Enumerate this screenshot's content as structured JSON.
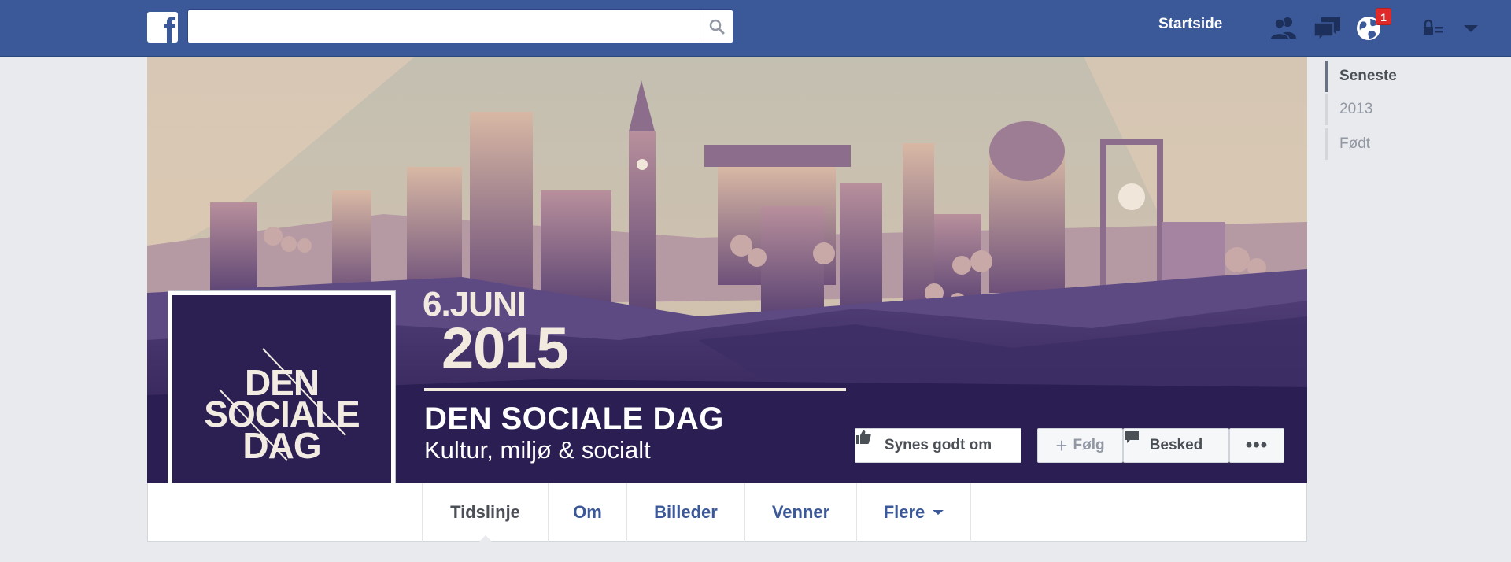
{
  "topbar": {
    "logo": "f",
    "search": {
      "value": "",
      "placeholder": ""
    },
    "home_label": "Startside",
    "notification_count": "1",
    "icons": [
      "friend-requests-icon",
      "messages-icon",
      "notifications-globe-icon",
      "privacy-lock-icon",
      "account-menu-chevron-icon"
    ]
  },
  "cover": {
    "date_day": "6.JUNI",
    "date_year": "2015",
    "page_name": "DEN SOCIALE DAG",
    "page_subtitle": "Kultur, miljø & socialt",
    "colors": {
      "sky": "#c8c2b4",
      "hills": "#3b2d63",
      "buildings": "#8c6e8c",
      "text": "#f3eadf"
    }
  },
  "profile": {
    "logo_lines": [
      "DEN",
      "SOCIALE",
      "DAG"
    ],
    "background": "#2c1f52"
  },
  "actions": {
    "like_label": "Synes godt om",
    "follow_label": "Følg",
    "message_label": "Besked",
    "more_label": "•••"
  },
  "tabs": [
    {
      "label": "Tidslinje",
      "active": true
    },
    {
      "label": "Om"
    },
    {
      "label": "Billeder"
    },
    {
      "label": "Venner"
    },
    {
      "label": "Flere"
    }
  ],
  "timeline_nav": [
    {
      "label": "Seneste",
      "active": true
    },
    {
      "label": "2013"
    },
    {
      "label": "Født"
    }
  ]
}
